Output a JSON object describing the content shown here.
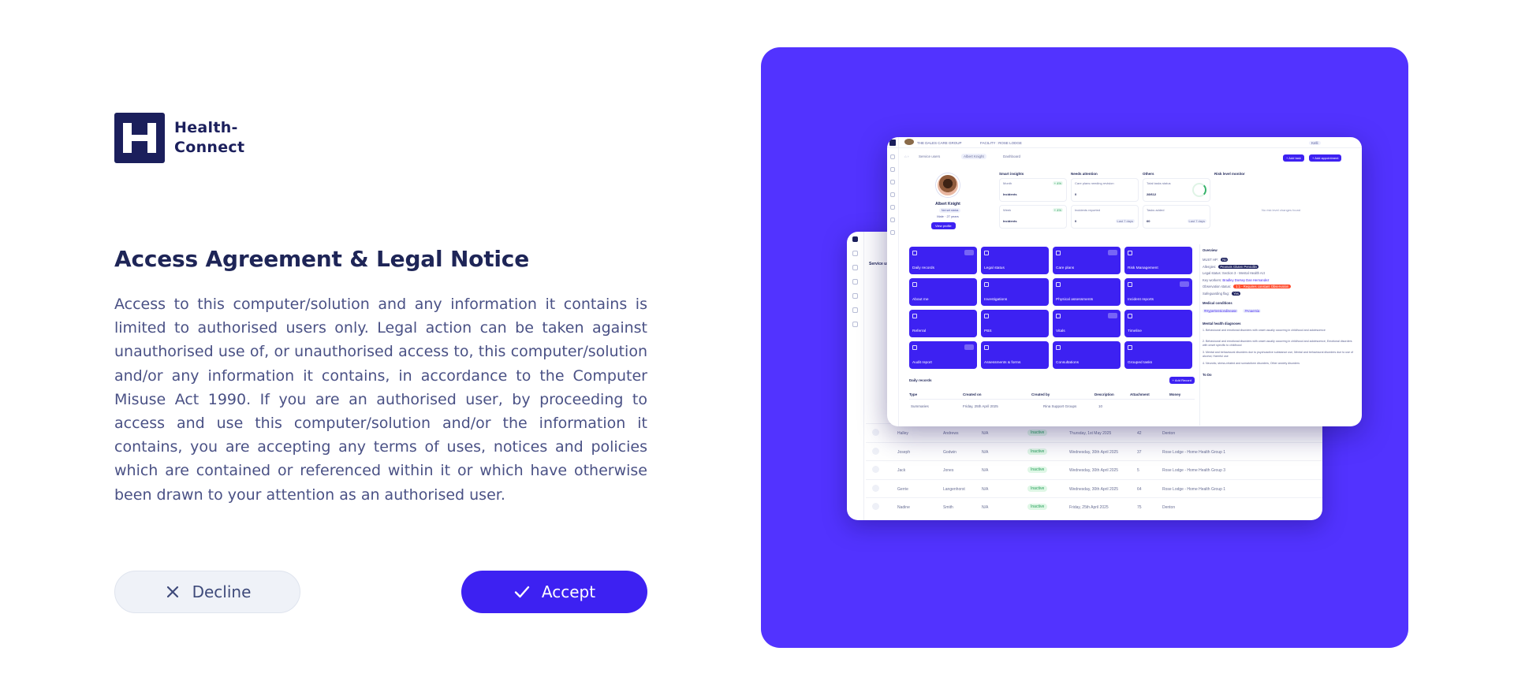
{
  "brand": {
    "name": "Health-\nConnect",
    "color": "#1b1f5c",
    "accent": "#3d21f2",
    "panel": "#5233ff"
  },
  "notice": {
    "title": "Access Agreement & Legal Notice",
    "body": "Access to this computer/solution and any information it contains is limited to authorised users only. Legal action can be taken against unauthorised use of, or unauthorised access to, this computer/solution and/or any information it contains, in accordance to the Computer Misuse Act 1990. If you are an authorised user, by proceeding to access and use this computer/solution and/or the information it contains, you are accepting any terms of uses, notices and policies which are contained or referenced within it or which have otherwise been drawn to your attention as an authorised user."
  },
  "actions": {
    "decline": "Decline",
    "accept": "Accept",
    "decline_icon": "close-icon",
    "accept_icon": "check-icon"
  },
  "preview": {
    "topbar": {
      "org": "THE DALES CARE GROUP",
      "facility": "FACILITY : ROSE LODGE",
      "user": "Kelli"
    },
    "breadcrumb": [
      "Service users",
      "Albert Knight",
      "Dashboard"
    ],
    "buttons": [
      "+ Add task",
      "+ Add appointment"
    ],
    "profile": {
      "name": "Albert Knight",
      "tag": "Not set status",
      "sex": "Male",
      "age": "27 years",
      "view": "View profile"
    },
    "smart_insights": {
      "title": "Smart insights",
      "cards": [
        {
          "label": "Month",
          "value": "Incidents",
          "chip": "+ 4%"
        },
        {
          "label": "Week",
          "value": "Incidents",
          "chip": "+ 4%"
        }
      ]
    },
    "needs_attention": {
      "title": "Needs attention",
      "cards": [
        {
          "label": "Care plans needing revision",
          "value": "0"
        },
        {
          "label": "Incidents reported",
          "value": "0",
          "chip": "Last 7 days"
        }
      ]
    },
    "others": {
      "title": "Others",
      "cards": [
        {
          "label": "Total tasks status",
          "value": "28/612"
        },
        {
          "label": "Tasks added",
          "value": "60",
          "chip": "Last 7 days"
        }
      ]
    },
    "risk": {
      "title": "Risk level monitor",
      "empty": "No risk level changes found"
    },
    "tiles": [
      "Daily records",
      "Legal status",
      "Care plans",
      "Risk Management",
      "About me",
      "Investigations",
      "Physical assessments",
      "Incident reports",
      "Referral",
      "PBS",
      "Vitals",
      "Timeline",
      "Audit report",
      "Assessments & forms",
      "Consultations",
      "Grouped tasks"
    ],
    "daily_records": {
      "title": "Daily records",
      "add": "+ Add Record",
      "columns": [
        "Type",
        "Created on",
        "Created by",
        "Description",
        "Attachment",
        "Money"
      ],
      "row": [
        "Summaries",
        "Friday, 25th April 2025",
        "Rina Support Groups",
        "10"
      ]
    },
    "overview": {
      "title": "Overview",
      "lines": [
        {
          "k": "MUST HP:",
          "v": "No"
        },
        {
          "k": "Allergies:",
          "v": "Peanuts  Gluten  Penicillin"
        },
        {
          "k": "Legal status:",
          "v": "Section 3 - Mental Health Act"
        },
        {
          "k": "Key workers:",
          "v": "Bradley Dorsey   Dan Hernandez"
        },
        {
          "k": "Observation status:",
          "v": "1:1 - Requires constant Observation"
        },
        {
          "k": "Safeguarding flag:",
          "v": "Yes"
        }
      ],
      "medical_title": "Medical conditions",
      "medical": [
        "#Hypertensiondisease",
        "#Anaemia"
      ],
      "mental_title": "Mental health diagnoses",
      "mental": [
        "1. Behavioural and emotional disorders with onset usually occurring in childhood and adolescence",
        "2. Behavioural and emotional disorders with onset usually occurring in childhood and adolescence, Emotional disorders with onset specific to childhood",
        "3. Mental and behavioural disorders due to psychoactive substance use, Mental and behavioural disorders due to use of alcohol, Harmful use",
        "4. Neurotic, stress-related and somatoform disorders, Other anxiety disorders"
      ],
      "todo_title": "To Do"
    },
    "back_rows": [
      [
        "Halley",
        "Andrews",
        "N/A",
        "Inactive",
        "Thursday, 1st May 2025",
        "42",
        "Denton"
      ],
      [
        "Joseph",
        "Godwin",
        "N/A",
        "Inactive",
        "Wednesday, 30th April 2025",
        "37",
        "Rose Lodge - Home Health Group 1"
      ],
      [
        "Jack",
        "Jones",
        "N/A",
        "Inactive",
        "Wednesday, 30th April 2025",
        "5",
        "Rose Lodge - Home Health Group 3"
      ],
      [
        "Gerrie",
        "Langenhorst",
        "N/A",
        "Inactive",
        "Wednesday, 30th April 2025",
        "64",
        "Rose Lodge - Home Health Group 1"
      ],
      [
        "Nadine",
        "Smith",
        "N/A",
        "Inactive",
        "Friday, 25th April 2025",
        "75",
        "Denton"
      ]
    ],
    "back_header": "Service users"
  }
}
